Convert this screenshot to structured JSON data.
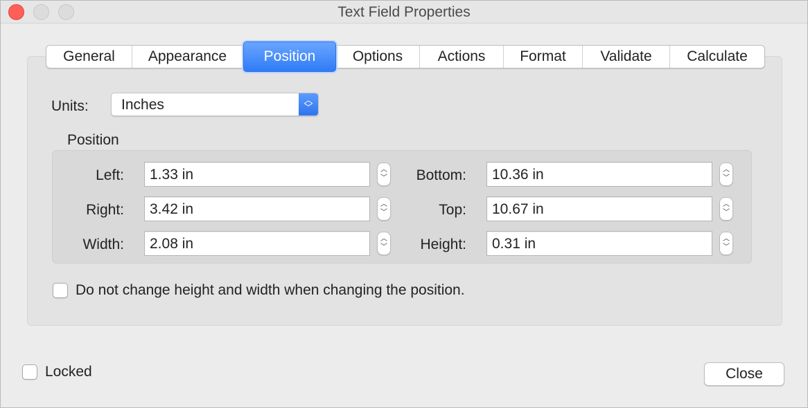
{
  "window": {
    "title": "Text Field Properties"
  },
  "tabs": [
    {
      "label": "General"
    },
    {
      "label": "Appearance"
    },
    {
      "label": "Position",
      "active": true
    },
    {
      "label": "Options"
    },
    {
      "label": "Actions"
    },
    {
      "label": "Format"
    },
    {
      "label": "Validate"
    },
    {
      "label": "Calculate"
    }
  ],
  "units": {
    "label": "Units:",
    "value": "Inches"
  },
  "position_group": {
    "title": "Position",
    "left": {
      "label": "Left:",
      "value": "1.33 in"
    },
    "right": {
      "label": "Right:",
      "value": "3.42 in"
    },
    "width": {
      "label": "Width:",
      "value": "2.08 in"
    },
    "bottom": {
      "label": "Bottom:",
      "value": "10.36 in"
    },
    "top": {
      "label": "Top:",
      "value": "10.67 in"
    },
    "height": {
      "label": "Height:",
      "value": "0.31 in"
    }
  },
  "keep_size_checkbox": {
    "label": "Do not change height and width when changing the position.",
    "checked": false
  },
  "locked_checkbox": {
    "label": "Locked",
    "checked": false
  },
  "close_button": {
    "label": "Close"
  },
  "colors": {
    "accent": "#2f7cf6",
    "background": "#ececec"
  }
}
